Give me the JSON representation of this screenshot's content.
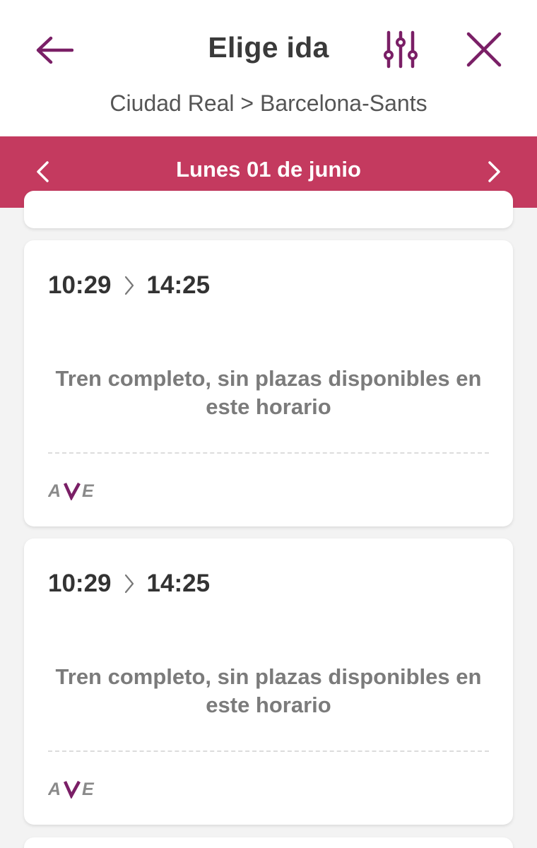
{
  "header": {
    "title": "Elige ida",
    "route": "Ciudad Real > Barcelona-Sants"
  },
  "date_bar": {
    "label": "Lunes 01 de junio"
  },
  "trips": [
    {
      "departure": "10:29",
      "arrival": "14:25",
      "status": "Tren completo, sin plazas disponibles en este horario",
      "brand_logo": "AVE"
    },
    {
      "departure": "10:29",
      "arrival": "14:25",
      "status": "Tren completo, sin plazas disponibles en este horario",
      "brand_logo": "AVE"
    }
  ],
  "colors": {
    "accent": "#7a1f66",
    "date_bar": "#c43a5f",
    "title_text": "#3a3a3a",
    "status_text": "#7b7b7b"
  },
  "icons": {
    "back": "arrow-left-icon",
    "filter": "sliders-icon",
    "close": "close-icon",
    "date_prev": "chevron-left-icon",
    "date_next": "chevron-right-icon",
    "time_separator": "chevron-right-icon"
  }
}
